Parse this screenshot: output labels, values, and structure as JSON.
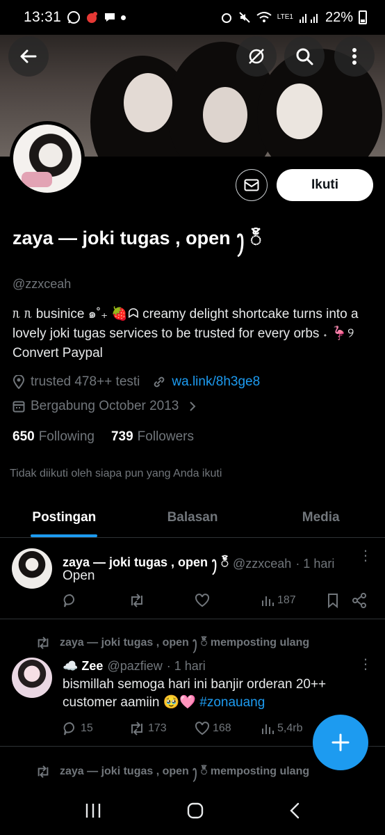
{
  "status": {
    "time": "13:31",
    "battery": "22%",
    "net": "LTE1"
  },
  "profile": {
    "name": "zaya — joki tugas , open ꫂ ၴႅၴ",
    "handle": "@zzxceah",
    "bio": "ᥰ ᥰ businice ๑˚₊ 🍓ᗣ creamy delight shortcake turns into a lovely joki tugas services to be trusted for every orbs ˖ 🦩୨ Convert Paypal",
    "location": "trusted 478++ testi",
    "link": "wa.link/8h3ge8",
    "joined": "Bergabung October 2013",
    "following_count": "650",
    "following_label": "Following",
    "followers_count": "739",
    "followers_label": "Followers",
    "not_followed": "Tidak diikuti oleh siapa pun yang Anda ikuti",
    "follow_button": "Ikuti"
  },
  "tabs": [
    {
      "label": "Postingan",
      "active": true
    },
    {
      "label": "Balasan",
      "active": false
    },
    {
      "label": "Media",
      "active": false
    }
  ],
  "posts": [
    {
      "name": "zaya — joki tugas , open ꫂ ၴႅၴ",
      "handle": "@zzxceah",
      "time": "· 1 hari",
      "text": "Open",
      "views": "187"
    },
    {
      "repost_by": "zaya — joki tugas , open ꫂ ၴႅၴ memposting ulang",
      "name": "☁️ Zee",
      "handle": "@pazfiew",
      "time": "· 1 hari",
      "text": "bismillah semoga hari ini banjir orderan 20++ customer aamiin 🥹🩷",
      "hashtag": "#zonauang",
      "replies": "15",
      "reposts": "173",
      "likes": "168",
      "views": "5,4rb"
    },
    {
      "repost_by": "zaya — joki tugas , open ꫂ ၴႅၴ memposting ulang"
    }
  ],
  "colors": {
    "accent": "#1d9bf0",
    "muted": "#71767b",
    "bg": "#000000"
  }
}
